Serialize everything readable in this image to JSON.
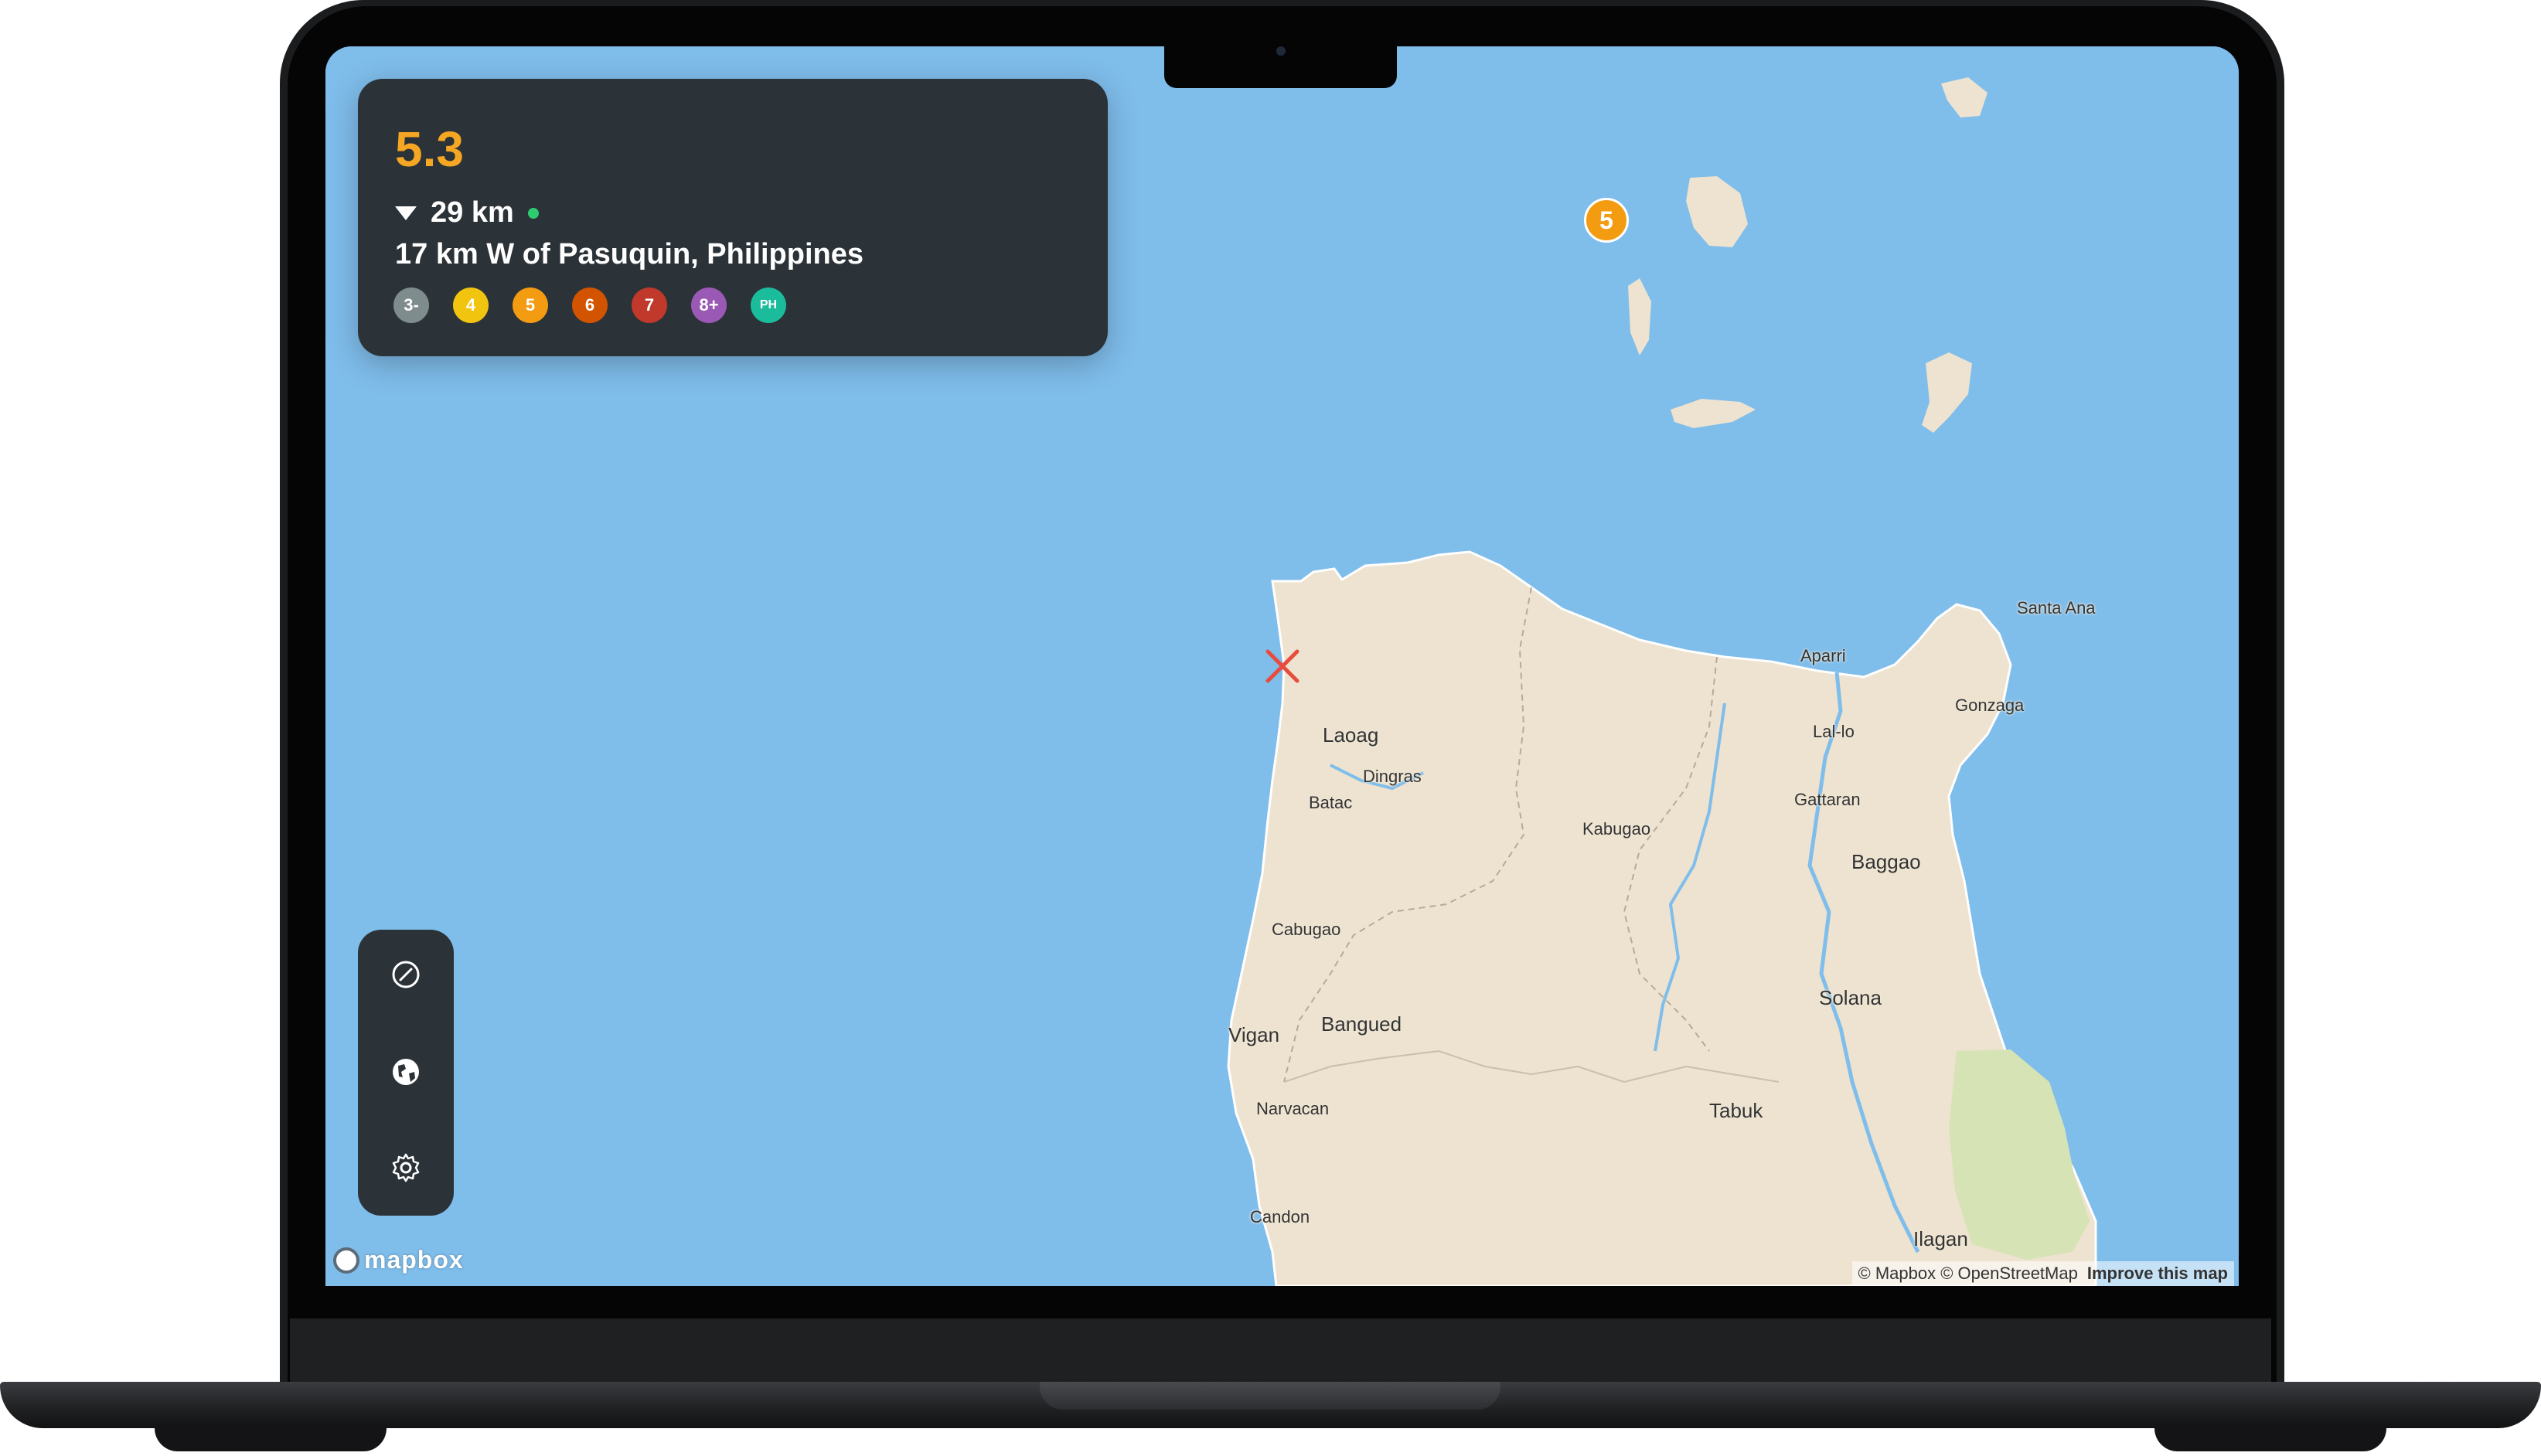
{
  "event": {
    "magnitude": "5.3",
    "depth": "29 km",
    "location": "17 km W of Pasuquin, Philippines"
  },
  "magnitude_legend": [
    {
      "label": "3-",
      "color": "#7f8c8d"
    },
    {
      "label": "4",
      "color": "#f1c40f"
    },
    {
      "label": "5",
      "color": "#f39c12"
    },
    {
      "label": "6",
      "color": "#d35400"
    },
    {
      "label": "7",
      "color": "#c0392b"
    },
    {
      "label": "8+",
      "color": "#9b59b6"
    },
    {
      "label": "PH",
      "color": "#1abc9c"
    }
  ],
  "map": {
    "cluster_marker": "5",
    "epicenter_icon": "x-marker-icon",
    "water_color": "#7fbdeb",
    "land_color": "#ede3d0",
    "park_color": "#d6e3b4",
    "places": {
      "laoag": "Laoag",
      "dingras": "Dingras",
      "batac": "Batac",
      "cabugao": "Cabugao",
      "vigan": "Vigan",
      "bangued": "Bangued",
      "narvacan": "Narvacan",
      "candon": "Candon",
      "kabugao": "Kabugao",
      "aparri": "Aparri",
      "lal_lo": "Lal-lo",
      "gattaran": "Gattaran",
      "baggao": "Baggao",
      "solana": "Solana",
      "tabuk": "Tabuk",
      "ilagan": "Ilagan",
      "santa_ana": "Santa Ana",
      "gonzaga": "Gonzaga"
    }
  },
  "toolbar": {
    "icons": [
      "compass-icon",
      "globe-icon",
      "gear-icon"
    ]
  },
  "branding": {
    "logo_text": "mapbox",
    "attribution": "© Mapbox © OpenStreetMap",
    "improve_link": "Improve this map"
  }
}
